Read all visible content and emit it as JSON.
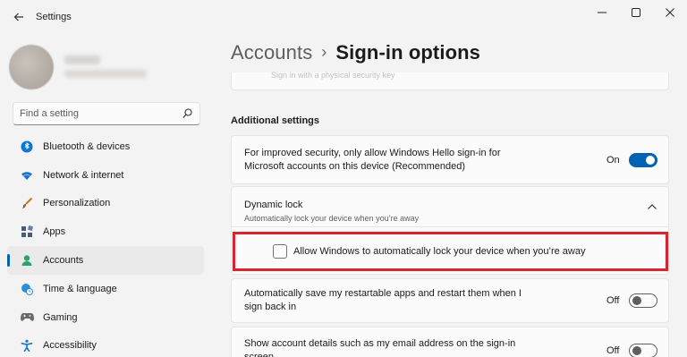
{
  "window": {
    "title": "Settings",
    "back_icon": "back-arrow-icon",
    "controls": [
      "minimize-icon",
      "maximize-icon",
      "close-icon"
    ]
  },
  "search": {
    "placeholder": "Find a setting",
    "icon": "search-icon"
  },
  "sidebar": {
    "items": [
      {
        "label": "Bluetooth & devices",
        "icon": "bluetooth-icon",
        "active": false
      },
      {
        "label": "Network & internet",
        "icon": "wifi-icon",
        "active": false
      },
      {
        "label": "Personalization",
        "icon": "brush-icon",
        "active": false
      },
      {
        "label": "Apps",
        "icon": "apps-icon",
        "active": false
      },
      {
        "label": "Accounts",
        "icon": "account-icon",
        "active": true
      },
      {
        "label": "Time & language",
        "icon": "globe-clock-icon",
        "active": false
      },
      {
        "label": "Gaming",
        "icon": "gamepad-icon",
        "active": false
      },
      {
        "label": "Accessibility",
        "icon": "accessibility-icon",
        "active": false
      }
    ]
  },
  "breadcrumb": {
    "parent": "Accounts",
    "separator": "›",
    "current": "Sign-in options"
  },
  "main": {
    "top_partial_text": "Sign in with a physical security key",
    "section_title": "Additional settings",
    "security_setting": {
      "line1": "For improved security, only allow Windows Hello sign-in for",
      "line2": "Microsoft accounts on this device (Recommended)",
      "state_label": "On",
      "enabled": true
    },
    "dynamic_lock": {
      "title": "Dynamic lock",
      "subtitle": "Automatically lock your device when you’re away",
      "expanded": true,
      "checkbox_label": "Allow Windows to automatically lock your device when you’re away",
      "checked": false
    },
    "restart_apps": {
      "line1": "Automatically save my restartable apps and restart them when I",
      "line2": "sign back in",
      "state_label": "Off",
      "enabled": false
    },
    "account_details": {
      "line1": "Show account details such as my email address on the sign-in",
      "line2": "screen",
      "state_label": "Off",
      "enabled": false
    }
  },
  "colors": {
    "accent": "#0063b1",
    "highlight_border": "#d9232d",
    "background": "#f3f3f3",
    "card": "#fbfbfb"
  }
}
